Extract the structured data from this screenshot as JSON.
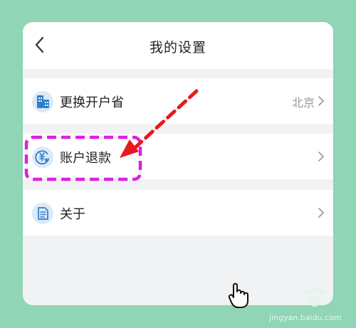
{
  "header": {
    "title": "我的设置",
    "back_icon": "chevron-left-icon"
  },
  "rows": [
    {
      "label": "更换开户省",
      "value": "北京",
      "icon": "building-icon"
    },
    {
      "label": "账户退款",
      "value": "",
      "icon": "refund-icon"
    },
    {
      "label": "关于",
      "value": "",
      "icon": "document-icon"
    }
  ],
  "colors": {
    "background": "#8fd5b6",
    "screen": "#f1f2f4",
    "icon_blue": "#2e7ec6",
    "annotation_red": "#e8191c",
    "annotation_magenta": "#e01fe0"
  },
  "watermark": {
    "url": "jingyan.baidu.com"
  }
}
